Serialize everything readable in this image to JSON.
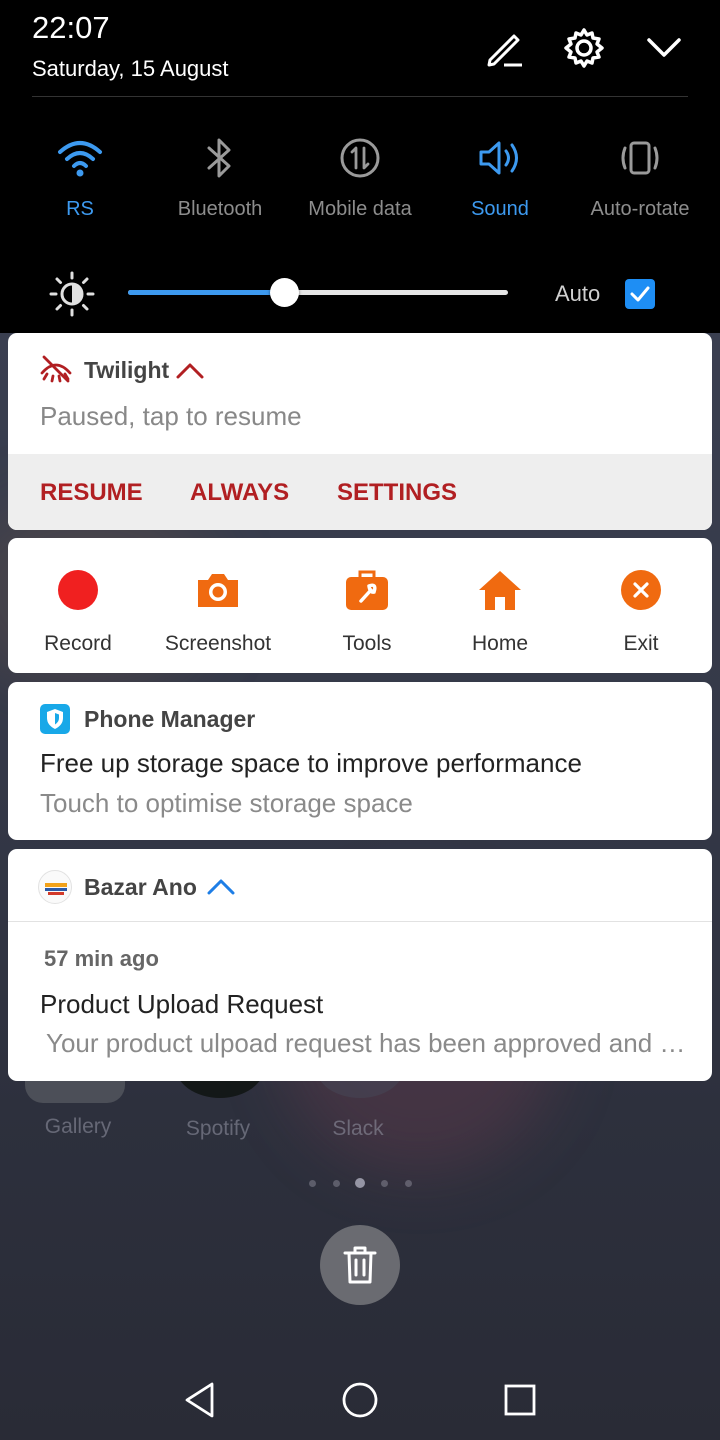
{
  "status": {
    "time": "22:07",
    "date": "Saturday, 15 August"
  },
  "header_icons": [
    "edit-icon",
    "settings-gear-icon",
    "collapse-chevron-icon"
  ],
  "toggles": [
    {
      "label": "RS",
      "icon": "wifi-icon",
      "active": true
    },
    {
      "label": "Bluetooth",
      "icon": "bluetooth-icon",
      "active": false
    },
    {
      "label": "Mobile data",
      "icon": "mobile-data-icon",
      "active": false
    },
    {
      "label": "Sound",
      "icon": "sound-icon",
      "active": true
    },
    {
      "label": "Auto-rotate",
      "icon": "auto-rotate-icon",
      "active": false
    }
  ],
  "brightness": {
    "level": 0.41,
    "auto_label": "Auto",
    "auto_checked": true
  },
  "twilight": {
    "app_name": "Twilight",
    "message": "Paused, tap to resume",
    "actions": [
      "RESUME",
      "ALWAYS",
      "SETTINGS"
    ]
  },
  "floating_bar": {
    "items": [
      {
        "label": "Record",
        "icon": "record-icon"
      },
      {
        "label": "Screenshot",
        "icon": "camera-icon"
      },
      {
        "label": "Tools",
        "icon": "toolbox-icon"
      },
      {
        "label": "Home",
        "icon": "home-icon"
      },
      {
        "label": "Exit",
        "icon": "exit-icon"
      }
    ]
  },
  "phone_manager": {
    "app_name": "Phone Manager",
    "title": "Free up storage space to improve performance",
    "subtitle": "Touch to optimise storage space"
  },
  "bazar": {
    "app_name": "Bazar Ano",
    "time_ago": "57 min ago",
    "title": "Product Upload Request",
    "body": "Your product ulpoad request has been approved and is now live on the store."
  },
  "home_apps": [
    "Gallery",
    "Spotify",
    "Slack"
  ],
  "colors": {
    "accent_blue": "#3d9af0",
    "twilight_red": "#b11f22",
    "floating_orange": "#f06a10",
    "record_red": "#f02020"
  }
}
